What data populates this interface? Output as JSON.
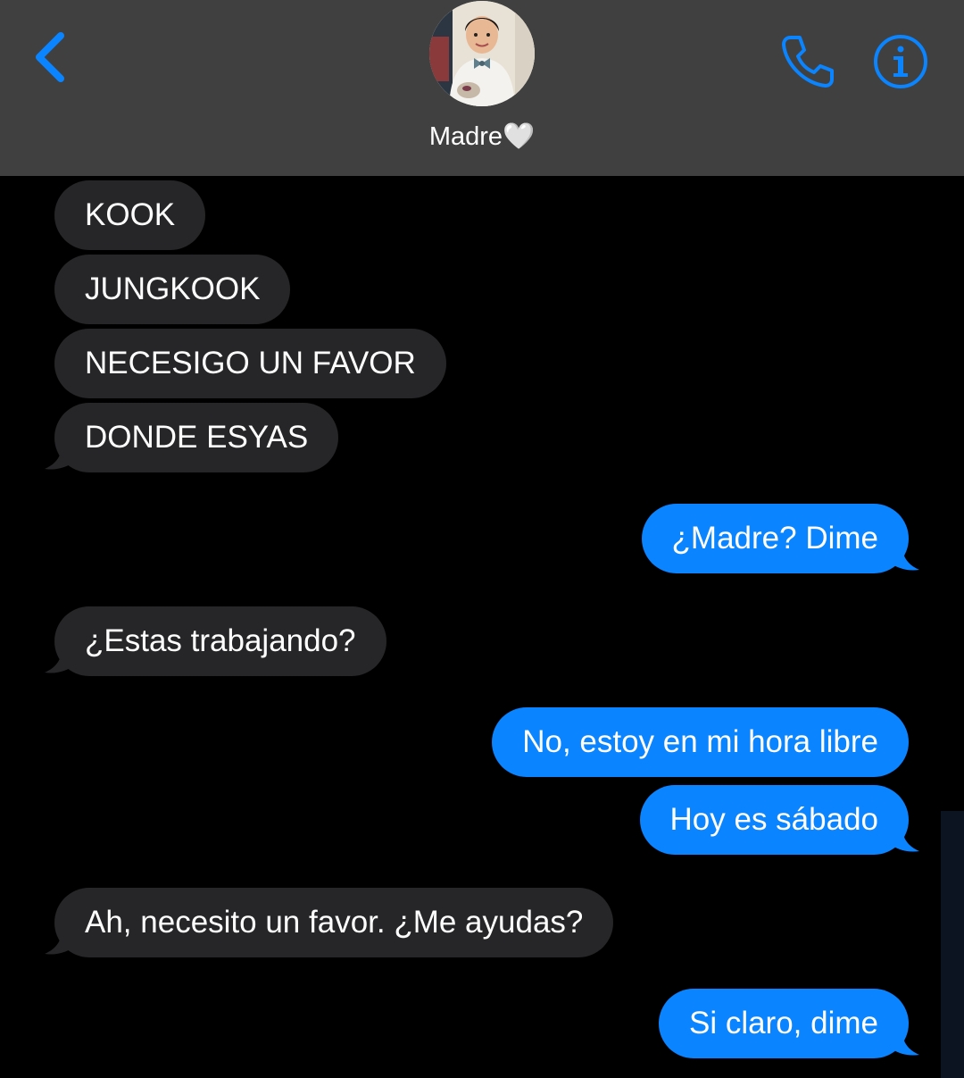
{
  "header": {
    "contact_name": "Madre🤍",
    "back_icon": "chevron-left-icon",
    "call_icon": "phone-icon",
    "info_icon": "info-icon",
    "accent_color": "#0a84ff"
  },
  "messages": [
    {
      "direction": "in",
      "text": "KOOK"
    },
    {
      "direction": "in",
      "text": "JUNGKOOK"
    },
    {
      "direction": "in",
      "text": "NECESIGO UN FAVOR"
    },
    {
      "direction": "in",
      "text": "DONDE ESYAS"
    },
    {
      "direction": "out",
      "text": "¿Madre? Dime"
    },
    {
      "direction": "in",
      "text": "¿Estas trabajando?"
    },
    {
      "direction": "out",
      "text": "No, estoy en mi hora libre"
    },
    {
      "direction": "out",
      "text": "Hoy es sábado"
    },
    {
      "direction": "in",
      "text": "Ah, necesito un favor. ¿Me ayudas?"
    },
    {
      "direction": "out",
      "text": "Si claro, dime"
    }
  ],
  "colors": {
    "incoming_bubble": "#262628",
    "outgoing_bubble": "#0a84ff",
    "header_bg": "#404040",
    "background": "#000000"
  }
}
